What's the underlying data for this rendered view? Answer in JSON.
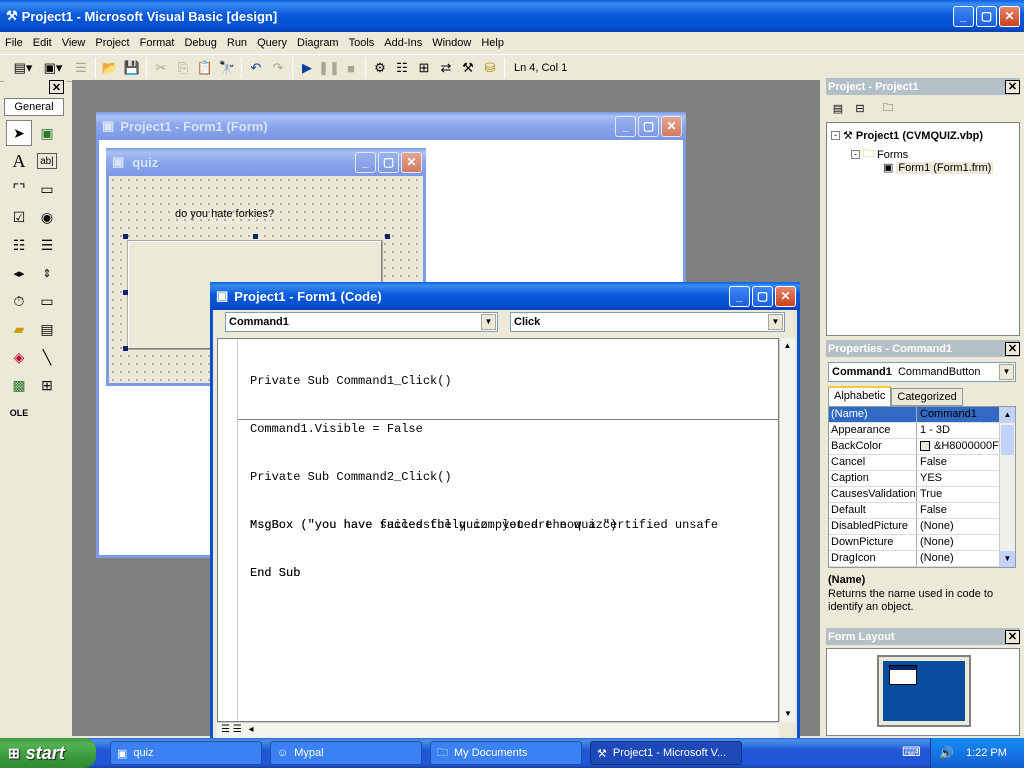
{
  "window": {
    "title": "Project1 - Microsoft Visual Basic [design]"
  },
  "menu": [
    "File",
    "Edit",
    "View",
    "Project",
    "Format",
    "Debug",
    "Run",
    "Query",
    "Diagram",
    "Tools",
    "Add-Ins",
    "Window",
    "Help"
  ],
  "toolbar": {
    "position": "Ln 4, Col 1"
  },
  "toolbox": {
    "tab": "General",
    "icons": [
      "pointer-icon",
      "picturebox-icon",
      "label-icon",
      "textbox-icon",
      "frame-icon",
      "commandbutton-icon",
      "checkbox-icon",
      "optionbutton-icon",
      "combobox-icon",
      "listbox-icon",
      "hscrollbar-icon",
      "vscrollbar-icon",
      "timer-icon",
      "drivelistbox-icon",
      "dirlistbox-icon",
      "filelistbox-icon",
      "shape-icon",
      "line-icon",
      "image-icon",
      "data-icon",
      "ole-icon"
    ]
  },
  "form_designer": {
    "title": "Project1 - Form1 (Form)"
  },
  "quiz_form": {
    "title": "quiz",
    "label": "do you hate forkies?"
  },
  "code_window": {
    "title": "Project1 - Form1 (Code)",
    "object": "Command1",
    "procedure": "Click",
    "lines1": [
      "Private Sub Command1_Click()",
      "Command1.Visible = False",
      "",
      "MsgBox (\"you have successfully completed the quiz\")",
      "End Sub"
    ],
    "lines2": [
      "Private Sub Command2_Click()",
      "MsgBox (\"you have failed the quiz. you are now a certified unsafe ",
      "End Sub"
    ]
  },
  "project": {
    "title": "Project - Project1",
    "root": "Project1 (CVMQUIZ.vbp)",
    "folder": "Forms",
    "file": "Form1 (Form1.frm)"
  },
  "properties": {
    "title": "Properties - Command1",
    "object": "Command1",
    "type": "CommandButton",
    "tabs": [
      "Alphabetic",
      "Categorized"
    ],
    "rows": [
      {
        "name": "(Name)",
        "value": "Command1"
      },
      {
        "name": "Appearance",
        "value": "1 - 3D"
      },
      {
        "name": "BackColor",
        "value": "&H8000000F"
      },
      {
        "name": "Cancel",
        "value": "False"
      },
      {
        "name": "Caption",
        "value": "YES"
      },
      {
        "name": "CausesValidation",
        "value": "True"
      },
      {
        "name": "Default",
        "value": "False"
      },
      {
        "name": "DisabledPicture",
        "value": "(None)"
      },
      {
        "name": "DownPicture",
        "value": "(None)"
      },
      {
        "name": "DragIcon",
        "value": "(None)"
      }
    ],
    "desc_title": "(Name)",
    "desc_text": "Returns the name used in code to identify an object."
  },
  "form_layout": {
    "title": "Form Layout"
  },
  "taskbar": {
    "start": "start",
    "items": [
      "quiz",
      "Mypal",
      "My Documents",
      "Project1 - Microsoft V..."
    ],
    "clock": "1:22 PM"
  },
  "colors": {
    "desktop": "#808080",
    "xp_blue": "#0550d0",
    "taskbar": "#2157d7",
    "start_green": "#3c9a3c"
  }
}
